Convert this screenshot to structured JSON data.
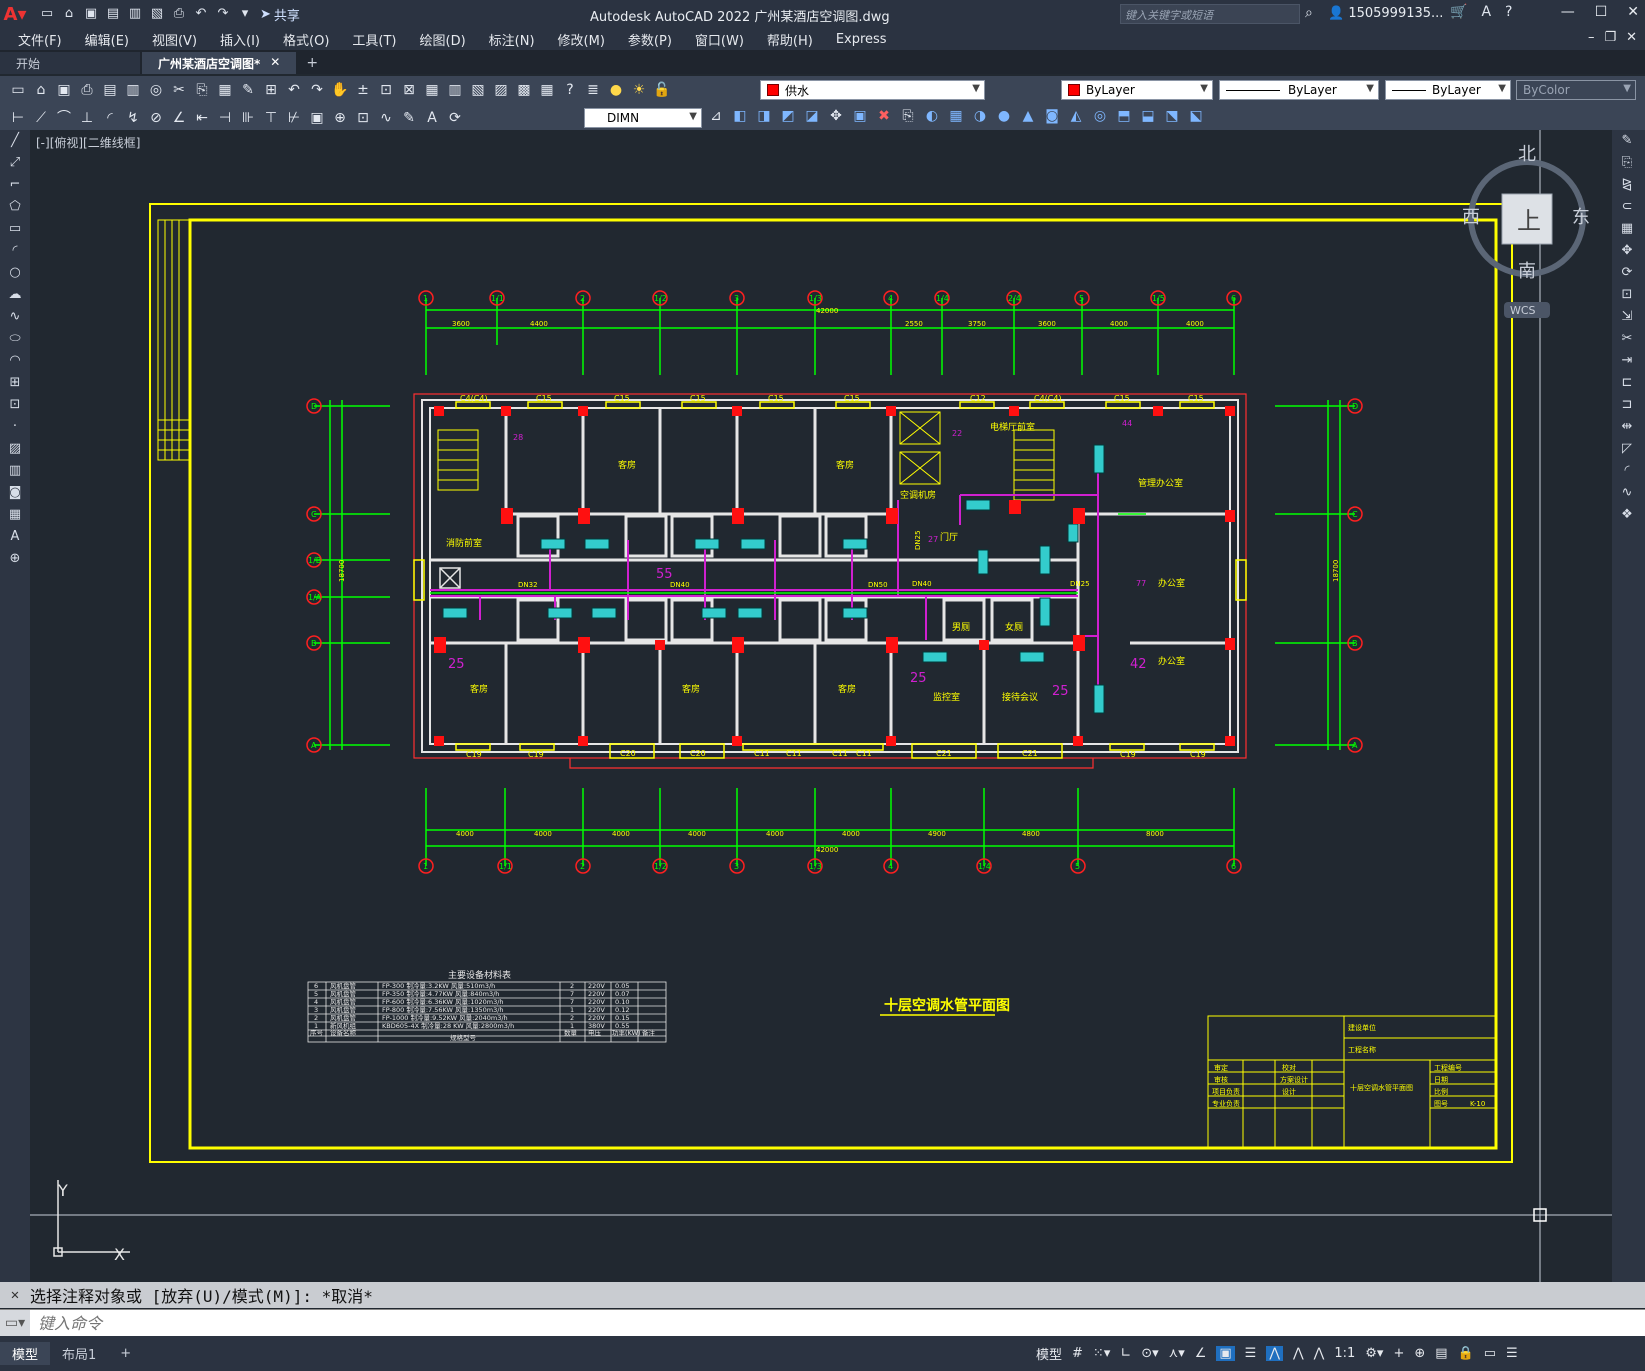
{
  "app": {
    "title": "Autodesk AutoCAD 2022    广州某酒店空调图.dwg",
    "share": "共享",
    "search_placeholder": "键入关键字或短语",
    "user": "1505999135...",
    "colors": {
      "titlebar": "#2b3341",
      "canvas": "#212830",
      "layer_red": "#ff0000",
      "frame_yellow": "#ffff00",
      "axis_green": "#00ff00"
    }
  },
  "menu": [
    "文件(F)",
    "编辑(E)",
    "视图(V)",
    "插入(I)",
    "格式(O)",
    "工具(T)",
    "绘图(D)",
    "标注(N)",
    "修改(M)",
    "参数(P)",
    "窗口(W)",
    "帮助(H)",
    "Express"
  ],
  "tabs": {
    "start": "开始",
    "active": "广州某酒店空调图*",
    "plus": "+"
  },
  "toolbar": {
    "layer": "供水",
    "color": "ByLayer",
    "linetype": "ByLayer",
    "lineweight": "ByLayer",
    "plotstyle": "ByColor",
    "dimstyle": "DIMN"
  },
  "viewport": {
    "label": "[-][俯视][二维线框]"
  },
  "viewcube": {
    "north": "北",
    "south": "南",
    "east": "东",
    "west": "西",
    "top": "上",
    "wcs": "WCS"
  },
  "ucs": {
    "x": "X",
    "y": "Y"
  },
  "drawing": {
    "title": "十层空调水管平面图",
    "table_title": "主要设备材料表",
    "top_axis_labels": [
      "1",
      "1/1",
      "2",
      "1/2",
      "3",
      "1/3",
      "4",
      "1/4",
      "2/4",
      "5",
      "1/5",
      "6"
    ],
    "top_dims": [
      "3600",
      "4400",
      "2550",
      "3750",
      "3600",
      "4000",
      "4000"
    ],
    "top_total": "42000",
    "bottom_axis_labels": [
      "1",
      "1/1",
      "2",
      "1/2",
      "3",
      "1/3",
      "4",
      "1/4",
      "5",
      "6"
    ],
    "bottom_dims": [
      "4000",
      "4000",
      "4000",
      "4000",
      "4000",
      "4000",
      "4900",
      "4800",
      "8000"
    ],
    "bottom_total": "42000",
    "side_axis_labels": [
      "D",
      "C",
      "1/B",
      "1/A",
      "B",
      "A"
    ],
    "side_total": "18700",
    "windows_top": [
      "C4(C4)",
      "C15",
      "C15",
      "C15",
      "C15",
      "C15",
      "C12",
      "C4(C4)",
      "C15",
      "C15"
    ],
    "windows_bottom": [
      "C19",
      "C19",
      "C20",
      "C20",
      "C11",
      "C11",
      "C11",
      "C11",
      "C21",
      "C21",
      "C19",
      "C19"
    ],
    "rooms": [
      "客房",
      "客房",
      "客房",
      "客房",
      "客房",
      "客房",
      "消防前室",
      "电梯厅前室",
      "管理办公室",
      "办公室",
      "办公室",
      "监控室",
      "接待会议",
      "男厕",
      "女厕",
      "空调机房",
      "门厅"
    ],
    "pipe_labels": [
      "DN32",
      "DN40",
      "DN50",
      "DN40",
      "DN25",
      "DN25"
    ],
    "numbers": [
      "28",
      "22",
      "44",
      "55",
      "27",
      "77",
      "25",
      "25",
      "25",
      "42"
    ],
    "table_rows": [
      [
        "6",
        "风机盘管",
        "FP-300 制冷量:3.2KW 风量:510m3/h",
        "2",
        "220V",
        "0.05"
      ],
      [
        "5",
        "风机盘管",
        "FP-350 制冷量:4.77KW 风量:840m3/h",
        "7",
        "220V",
        "0.07"
      ],
      [
        "4",
        "风机盘管",
        "FP-600 制冷量:6.36KW 风量:1020m3/h",
        "7",
        "220V",
        "0.10"
      ],
      [
        "3",
        "风机盘管",
        "FP-800 制冷量:7.56KW 风量:1350m3/h",
        "1",
        "220V",
        "0.12"
      ],
      [
        "2",
        "风机盘管",
        "FP-1000 制冷量:9.52KW 风量:2040m3/h",
        "2",
        "220V",
        "0.15"
      ],
      [
        "1",
        "新风机组",
        "KBD605-4X 制冷量:28 KW 风量:2800m3/h",
        "1",
        "380V",
        "0.55"
      ]
    ],
    "table_header": [
      "序号",
      "设备名称",
      "规格型号",
      "数量",
      "电压",
      "功率(KW)",
      "备注"
    ],
    "title_block": [
      "建设单位",
      "工程名称",
      "审定",
      "审核",
      "项目负责",
      "专业负责",
      "校对",
      "方案设计",
      "设计",
      "十层空调水管平面图",
      "工程编号",
      "日期",
      "比例",
      "图号",
      "K-10"
    ]
  },
  "command": {
    "history": "选择注释对象或 [放弃(U)/模式(M)]: *取消*",
    "placeholder": "键入命令"
  },
  "status": {
    "tabs": [
      "模型",
      "布局1",
      "+"
    ],
    "model": "模型",
    "scale": "1:1"
  }
}
